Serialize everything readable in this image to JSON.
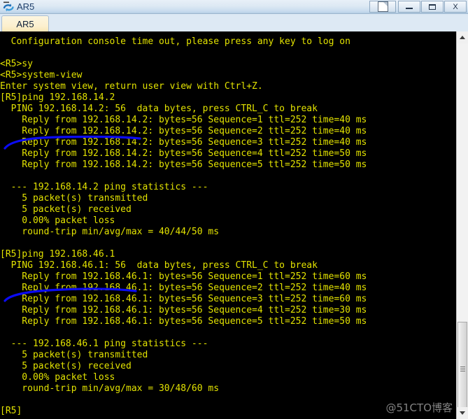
{
  "window": {
    "title": "AR5",
    "icon": "router-icon",
    "buttons": {
      "restore_label": "",
      "minimize_label": "",
      "maximize_label": "",
      "close_label": "X"
    }
  },
  "tabs": [
    {
      "label": "AR5",
      "active": true
    }
  ],
  "terminal": {
    "foreground_color": "#e2e200",
    "background_color": "#000000",
    "annotation_color": "#0000ff",
    "lines": [
      "  Configuration console time out, please press any key to log on",
      "",
      "<R5>sy",
      "<R5>system-view",
      "Enter system view, return user view with Ctrl+Z.",
      "[R5]ping 192.168.14.2",
      "  PING 192.168.14.2: 56  data bytes, press CTRL_C to break",
      "    Reply from 192.168.14.2: bytes=56 Sequence=1 ttl=252 time=40 ms",
      "    Reply from 192.168.14.2: bytes=56 Sequence=2 ttl=252 time=40 ms",
      "    Reply from 192.168.14.2: bytes=56 Sequence=3 ttl=252 time=40 ms",
      "    Reply from 192.168.14.2: bytes=56 Sequence=4 ttl=252 time=50 ms",
      "    Reply from 192.168.14.2: bytes=56 Sequence=5 ttl=252 time=50 ms",
      "",
      "  --- 192.168.14.2 ping statistics ---",
      "    5 packet(s) transmitted",
      "    5 packet(s) received",
      "    0.00% packet loss",
      "    round-trip min/avg/max = 40/44/50 ms",
      "",
      "[R5]ping 192.168.46.1",
      "  PING 192.168.46.1: 56  data bytes, press CTRL_C to break",
      "    Reply from 192.168.46.1: bytes=56 Sequence=1 ttl=252 time=60 ms",
      "    Reply from 192.168.46.1: bytes=56 Sequence=2 ttl=252 time=40 ms",
      "    Reply from 192.168.46.1: bytes=56 Sequence=3 ttl=252 time=60 ms",
      "    Reply from 192.168.46.1: bytes=56 Sequence=4 ttl=252 time=30 ms",
      "    Reply from 192.168.46.1: bytes=56 Sequence=5 ttl=252 time=50 ms",
      "",
      "  --- 192.168.46.1 ping statistics ---",
      "    5 packet(s) transmitted",
      "    5 packet(s) received",
      "    0.00% packet loss",
      "    round-trip min/avg/max = 30/48/60 ms",
      "",
      "[R5]"
    ],
    "ping_sessions": [
      {
        "command": "ping 192.168.14.2",
        "prompt": "[R5]",
        "target": "192.168.14.2",
        "data_bytes": 56,
        "replies": [
          {
            "sequence": 1,
            "bytes": 56,
            "ttl": 252,
            "time_ms": 40
          },
          {
            "sequence": 2,
            "bytes": 56,
            "ttl": 252,
            "time_ms": 40
          },
          {
            "sequence": 3,
            "bytes": 56,
            "ttl": 252,
            "time_ms": 40
          },
          {
            "sequence": 4,
            "bytes": 56,
            "ttl": 252,
            "time_ms": 50
          },
          {
            "sequence": 5,
            "bytes": 56,
            "ttl": 252,
            "time_ms": 50
          }
        ],
        "statistics": {
          "transmitted": 5,
          "received": 5,
          "packet_loss": "0.00%",
          "min_ms": 40,
          "avg_ms": 44,
          "max_ms": 50
        }
      },
      {
        "command": "ping 192.168.46.1",
        "prompt": "[R5]",
        "target": "192.168.46.1",
        "data_bytes": 56,
        "replies": [
          {
            "sequence": 1,
            "bytes": 56,
            "ttl": 252,
            "time_ms": 60
          },
          {
            "sequence": 2,
            "bytes": 56,
            "ttl": 252,
            "time_ms": 40
          },
          {
            "sequence": 3,
            "bytes": 56,
            "ttl": 252,
            "time_ms": 60
          },
          {
            "sequence": 4,
            "bytes": 56,
            "ttl": 252,
            "time_ms": 30
          },
          {
            "sequence": 5,
            "bytes": 56,
            "ttl": 252,
            "time_ms": 50
          }
        ],
        "statistics": {
          "transmitted": 5,
          "received": 5,
          "packet_loss": "0.00%",
          "min_ms": 30,
          "avg_ms": 48,
          "max_ms": 60
        }
      }
    ],
    "current_prompt": "[R5]"
  },
  "scrollbar": {
    "up_label": "",
    "down_label": ""
  },
  "watermark": {
    "text": "@51CTO博客"
  }
}
